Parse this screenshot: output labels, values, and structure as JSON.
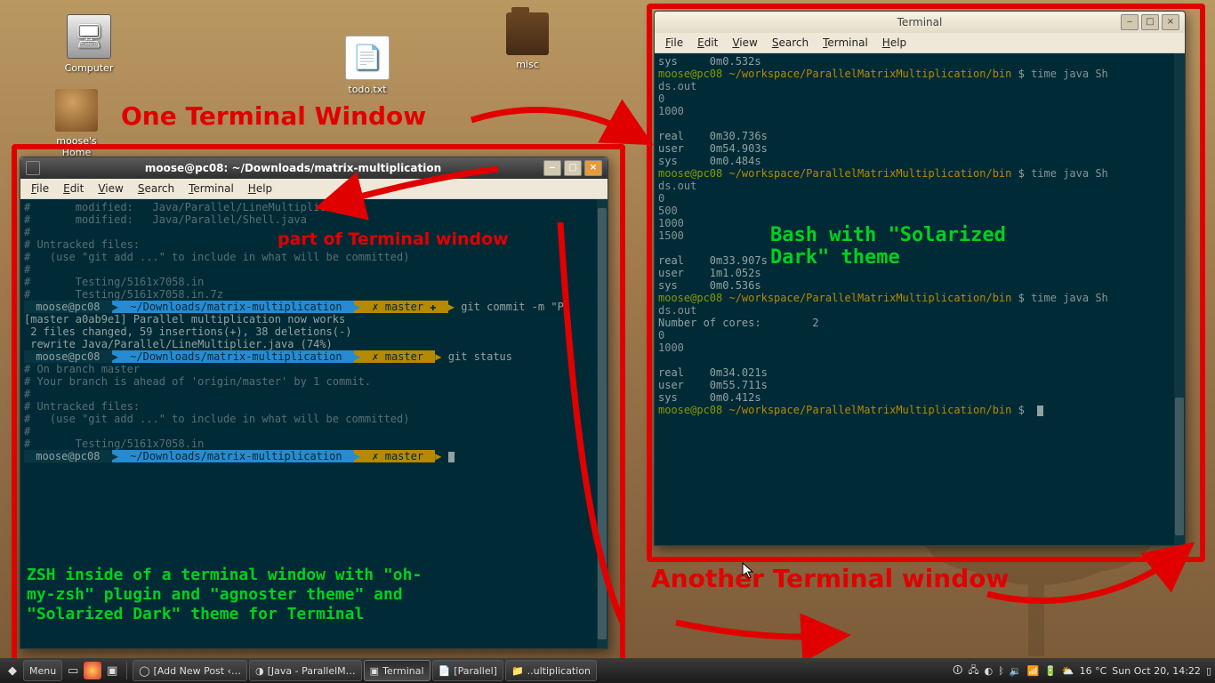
{
  "desktop": {
    "icons": {
      "computer": "Computer",
      "home": "moose's Home",
      "todo": "todo.txt",
      "misc": "misc"
    }
  },
  "annotations": {
    "one_terminal": "One Terminal Window",
    "another_terminal": "Another Terminal window",
    "part_of": "part of Terminal window",
    "bash_solarized": "Bash with \"Solarized\nDark\" theme",
    "zsh_desc": "ZSH inside of a terminal window with \"oh-\nmy-zsh\" plugin and \"agnoster theme\" and\n\"Solarized Dark\" theme for Terminal"
  },
  "window_left": {
    "title": "moose@pc08: ~/Downloads/matrix-multiplication",
    "menu": {
      "file": "File",
      "edit": "Edit",
      "view": "View",
      "search": "Search",
      "terminal": "Terminal",
      "help": "Help"
    },
    "lines": {
      "l1": "#       modified:   Java/Parallel/LineMultiplier.java",
      "l2": "#       modified:   Java/Parallel/Shell.java",
      "l3": "#",
      "l4": "# Untracked files:",
      "l5": "#   (use \"git add <file>...\" to include in what will be committed)",
      "l6": "#",
      "l7": "#       Testing/5161x7058.in",
      "l8": "#       Testing/5161x7058.in.7z",
      "p1_user": " moose@pc08 ",
      "p1_path": " ~/Downloads/matrix-multiplication ",
      "p1_branch": " ✗ master ✚ ",
      "p1_cmd": " git commit -m \"Pa",
      "l9": "[master a0ab9e1] Parallel multiplication now works",
      "l10": " 2 files changed, 59 insertions(+), 38 deletions(-)",
      "l11": " rewrite Java/Parallel/LineMultiplier.java (74%)",
      "p2_cmd": " git status",
      "p2_branch": " ✗ master ",
      "l12": "# On branch master",
      "l13": "# Your branch is ahead of 'origin/master' by 1 commit.",
      "l14": "#",
      "l15": "# Untracked files:",
      "l16": "#   (use \"git add <file>...\" to include in what will be committed)",
      "l17": "#",
      "l18": "#       Testing/5161x7058.in"
    }
  },
  "window_right": {
    "title": "Terminal",
    "menu": {
      "file": "File",
      "edit": "Edit",
      "view": "View",
      "search": "Search",
      "terminal": "Terminal",
      "help": "Help"
    },
    "content": "sys     0m0.532s\nmoose@pc08 ~/workspace/ParallelMatrixMultiplication/bin $ time java Sh\nds.out\n0\n1000\n\nreal    0m30.736s\nuser    0m54.903s\nsys     0m0.484s\nmoose@pc08 ~/workspace/ParallelMatrixMultiplication/bin $ time java Sh\nds.out\n0\n500\n1000\n1500\n\nreal    0m33.907s\nuser    1m1.052s\nsys     0m0.536s\nmoose@pc08 ~/workspace/ParallelMatrixMultiplication/bin $ time java Sh\nds.out\nNumber of cores:        2\n0\n1000\n\nreal    0m34.021s\nuser    0m55.711s\nsys     0m0.412s\nmoose@pc08 ~/workspace/ParallelMatrixMultiplication/bin $ ",
    "prompt_user": "moose@pc08",
    "prompt_path": "~/workspace/ParallelMatrixMultiplication/bin"
  },
  "taskbar": {
    "menu": "Menu",
    "tasks": {
      "t1": "[Add New Post ‹…",
      "t2": "[Java - ParallelM…",
      "t3": "Terminal",
      "t4": "[Parallel]",
      "t5": "..ultiplication"
    },
    "weather": "16 °C",
    "clock": "Sun Oct 20, 14:22"
  }
}
